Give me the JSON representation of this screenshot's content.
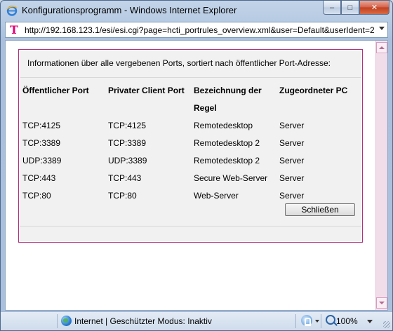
{
  "window": {
    "title": "Konfigurationsprogramm - Windows Internet Explorer",
    "controls": {
      "minimize": "–",
      "maximize": "□",
      "close": "✕"
    }
  },
  "addressbar": {
    "logo": "T",
    "url": "http://192.168.123.1/esi/esi.cgi?page=hcti_portrules_overview.xml&user=Default&userIdent=2"
  },
  "dialog": {
    "info": "Informationen über alle vergebenen Ports, sortiert nach öffentlicher Port-Adresse:",
    "columns": [
      "Öffentlicher Port",
      "Privater Client Port",
      "Bezeichnung der",
      "Zugeordneter PC"
    ],
    "column2_line2": "Regel",
    "rows": [
      [
        "TCP:4125",
        "TCP:4125",
        "Remotedesktop",
        "Server"
      ],
      [
        "TCP:3389",
        "TCP:3389",
        "Remotedesktop 2",
        "Server"
      ],
      [
        "UDP:3389",
        "UDP:3389",
        "Remotedesktop 2",
        "Server"
      ],
      [
        "TCP:443",
        "TCP:443",
        "Secure Web-Server",
        "Server"
      ],
      [
        "TCP:80",
        "TCP:80",
        "Web-Server",
        "Server"
      ]
    ],
    "close_label": "Schließen"
  },
  "statusbar": {
    "zone_text": "Internet | Geschützter Modus: Inaktiv",
    "zoom": "100%"
  },
  "colors": {
    "panel_border": "#b0307b",
    "brand_magenta": "#e20074",
    "scrollbar": "#f4e3ee"
  }
}
